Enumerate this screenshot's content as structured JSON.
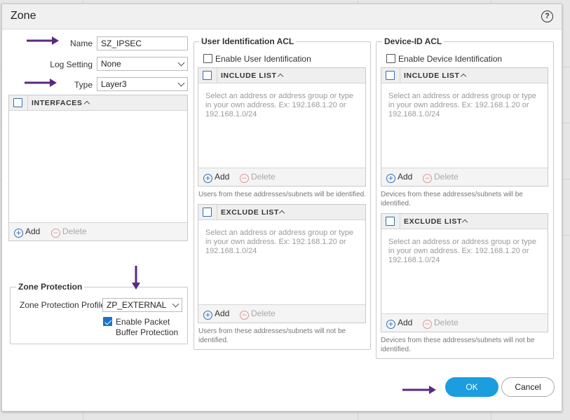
{
  "dialog": {
    "title": "Zone",
    "help_icon": "?"
  },
  "general": {
    "name_label": "Name",
    "name_value": "SZ_IPSEC",
    "log_setting_label": "Log Setting",
    "log_setting_value": "None",
    "type_label": "Type",
    "type_value": "Layer3"
  },
  "interfaces": {
    "header": "INTERFACES",
    "add_label": "Add",
    "delete_label": "Delete"
  },
  "zone_protection": {
    "group_title": "Zone Protection",
    "profile_label": "Zone Protection Profile",
    "profile_value": "ZP_EXTERNAL",
    "buffer_label_line1": "Enable Packet",
    "buffer_label_line2": "Buffer Protection",
    "buffer_checked": true
  },
  "user_id_acl": {
    "group_title": "User Identification ACL",
    "enable_label": "Enable User Identification",
    "include": {
      "header": "INCLUDE LIST",
      "placeholder": "Select an address or address group or type in your own address. Ex: 192.168.1.20 or 192.168.1.0/24",
      "add_label": "Add",
      "delete_label": "Delete",
      "note": "Users from these addresses/subnets will be identified."
    },
    "exclude": {
      "header": "EXCLUDE LIST",
      "placeholder": "Select an address or address group or type in your own address. Ex: 192.168.1.20 or 192.168.1.0/24",
      "add_label": "Add",
      "delete_label": "Delete",
      "note_line1": "Users from these addresses/subnets will not be",
      "note_line2": "identified."
    }
  },
  "device_id_acl": {
    "group_title": "Device-ID ACL",
    "enable_label": "Enable Device Identification",
    "include": {
      "header": "INCLUDE LIST",
      "placeholder": "Select an address or address group or type in your own address. Ex: 192.168.1.20 or 192.168.1.0/24",
      "add_label": "Add",
      "delete_label": "Delete",
      "note_line1": "Devices from these addresses/subnets will be",
      "note_line2": "identified."
    },
    "exclude": {
      "header": "EXCLUDE LIST",
      "placeholder": "Select an address or address group or type in your own address. Ex: 192.168.1.20 or 192.168.1.0/24",
      "add_label": "Add",
      "delete_label": "Delete",
      "note_line1": "Devices from these addresses/subnets will not be",
      "note_line2": "identified."
    }
  },
  "footer": {
    "ok_label": "OK",
    "cancel_label": "Cancel"
  },
  "colors": {
    "primary": "#1b9de0",
    "annotation_arrow": "#5a2a82",
    "link_icon": "#2f6fb3"
  }
}
